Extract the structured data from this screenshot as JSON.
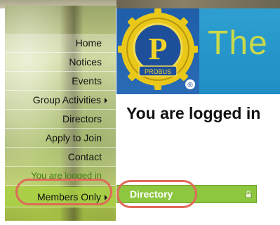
{
  "nav": {
    "items": [
      {
        "label": "Home"
      },
      {
        "label": "Notices"
      },
      {
        "label": "Events"
      },
      {
        "label": "Group Activities",
        "has_submenu": true
      },
      {
        "label": "Directors"
      },
      {
        "label": "Apply to Join"
      },
      {
        "label": "Contact"
      }
    ],
    "status": "You are logged in",
    "members": {
      "label": "Members Only",
      "has_submenu": true
    }
  },
  "header": {
    "title": "The P",
    "logo": {
      "letter": "P",
      "banner": "PROBUS",
      "registered": "®"
    }
  },
  "main": {
    "heading": "You are logged in"
  },
  "submenu": {
    "item": "Directory",
    "icon": "lock-icon"
  },
  "colors": {
    "submenu_bg": "#8dc63f",
    "annotation_ring": "#e06a5a",
    "header_blue": "#1f5ea8",
    "header_teal": "#2e9fd0",
    "title_green": "#c9d94a"
  }
}
